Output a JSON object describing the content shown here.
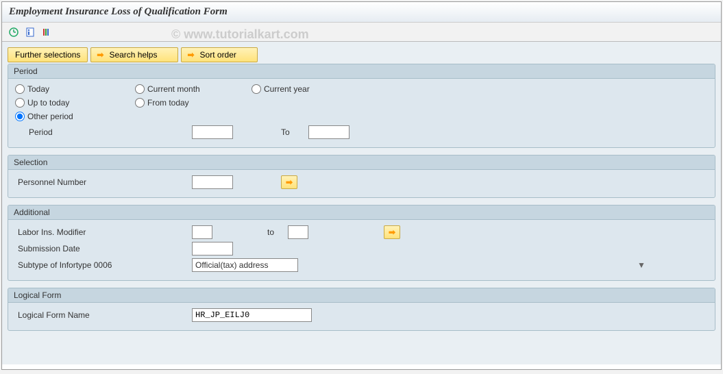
{
  "title": "Employment Insurance Loss of Qualification Form",
  "watermark": "© www.tutorialkart.com",
  "buttons": {
    "further": "Further selections",
    "search": "Search helps",
    "sort": "Sort order"
  },
  "period": {
    "header": "Period",
    "today": "Today",
    "current_month": "Current month",
    "current_year": "Current year",
    "up_to_today": "Up to today",
    "from_today": "From today",
    "other": "Other period",
    "period_label": "Period",
    "to_label": "To",
    "from_value": "",
    "to_value": ""
  },
  "selection": {
    "header": "Selection",
    "personnel_number": "Personnel Number",
    "personnel_value": ""
  },
  "additional": {
    "header": "Additional",
    "labor_ins": "Labor Ins. Modifier",
    "labor_from": "",
    "to_label": "to",
    "labor_to": "",
    "submission_date": "Submission Date",
    "submission_value": "",
    "subtype": "Subtype of Infortype 0006",
    "subtype_value": "Official(tax) address"
  },
  "logical_form": {
    "header": "Logical Form",
    "name_label": "Logical Form Name",
    "name_value": "HR_JP_EILJ0"
  }
}
